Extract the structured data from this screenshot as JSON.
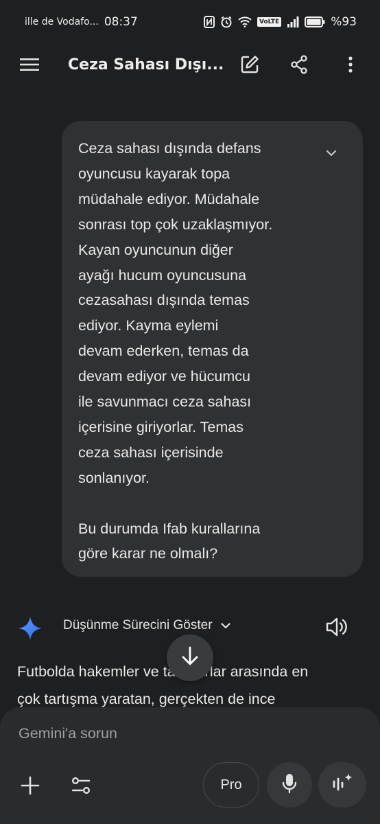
{
  "status_bar": {
    "carrier": "ille de Vodafo...",
    "time": "08:37",
    "volte": "VoLTE",
    "battery": "%93"
  },
  "app_bar": {
    "title": "Ceza Sahası Dışı...",
    "icons": [
      "menu-icon",
      "edit-icon",
      "share-icon",
      "more-vert-icon"
    ]
  },
  "conversation": {
    "user_message": {
      "lines": [
        "Ceza sahası dışında defans",
        "oyuncusu kayarak topa",
        "müdahale ediyor. Müdahale",
        "sonrası top çok uzaklaşmıyor.",
        "Kayan oyuncunun diğer",
        "ayağı hucum oyuncusuna",
        "cezasahası dışında temas",
        "ediyor. Kayma eylemi",
        "devam ederken, temas da",
        "devam ediyor ve hücumcu",
        "ile savunmacı ceza sahası",
        "içerisine giriyorlar. Temas",
        "ceza sahası içerisinde",
        "sonlanıyor."
      ],
      "question": [
        "Bu durumda Ifab kurallarına",
        "göre karar ne olmalı?"
      ]
    },
    "thinking_label": "Düşünme Sürecini Göster",
    "response_lines": [
      "Futbolda hakemler ve taraftarlar arasında en",
      "çok tartışma yaratan, gerçekten de ince"
    ]
  },
  "composer": {
    "placeholder": "Gemini'a sorun",
    "pro_label": "Pro"
  },
  "colors": {
    "background": "#1e1f20",
    "bubble": "#303133",
    "composer": "#2a2b2d",
    "gemini_blue": "#4285f4"
  }
}
